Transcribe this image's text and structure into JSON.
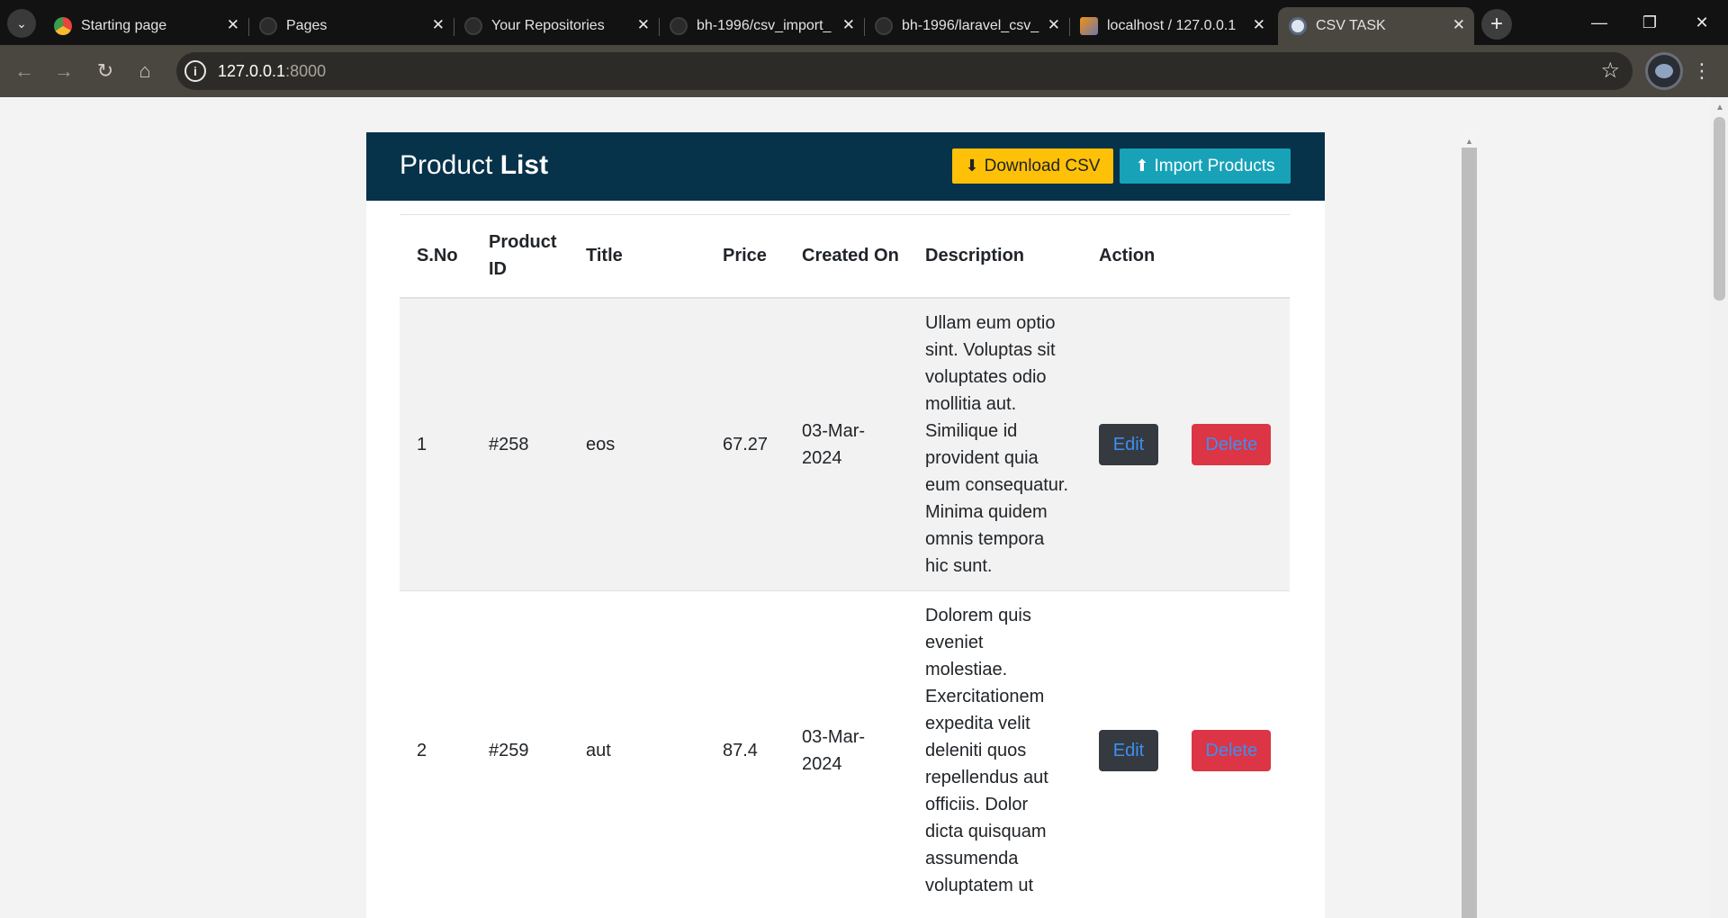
{
  "browser": {
    "tabs": [
      {
        "title": "Starting page",
        "icon": "browser-logo-icon",
        "active": false
      },
      {
        "title": "Pages",
        "icon": "github-icon",
        "active": false
      },
      {
        "title": "Your Repositories",
        "icon": "github-icon",
        "active": false
      },
      {
        "title": "bh-1996/csv_import_",
        "icon": "github-icon",
        "active": false
      },
      {
        "title": "bh-1996/laravel_csv_",
        "icon": "github-icon",
        "active": false
      },
      {
        "title": "localhost / 127.0.0.1",
        "icon": "phpmyadmin-icon",
        "active": false
      },
      {
        "title": "CSV TASK",
        "icon": "page-icon",
        "active": true
      }
    ],
    "url_host": "127.0.0.1",
    "url_port": ":8000"
  },
  "header": {
    "title_normal": "Product",
    "title_bold": "List",
    "download_label": "Download CSV",
    "import_label": "Import Products",
    "colors": {
      "header_bg": "#06324a",
      "download_bg": "#ffc107",
      "import_bg": "#17a2b8"
    }
  },
  "table": {
    "columns": [
      "S.No",
      "Product ID",
      "Title",
      "Price",
      "Created On",
      "Description",
      "Action"
    ],
    "rows": [
      {
        "sno": "1",
        "product_id": "#258",
        "title": "eos",
        "price": "67.27",
        "created_on": "03-Mar-2024",
        "description": "Ullam eum optio sint. Voluptas sit voluptates odio mollitia aut. Similique id provident quia eum consequatur. Minima quidem omnis tempora hic sunt.",
        "edit_label": "Edit",
        "delete_label": "Delete"
      },
      {
        "sno": "2",
        "product_id": "#259",
        "title": "aut",
        "price": "87.4",
        "created_on": "03-Mar-2024",
        "description": "Dolorem quis eveniet molestiae. Exercitationem expedita velit deleniti quos repellendus aut officiis. Dolor dicta quisquam assumenda voluptatem ut",
        "edit_label": "Edit",
        "delete_label": "Delete"
      }
    ],
    "colors": {
      "edit_bg": "#343a40",
      "delete_bg": "#dc3545",
      "button_text": "#3d8ff2"
    }
  }
}
